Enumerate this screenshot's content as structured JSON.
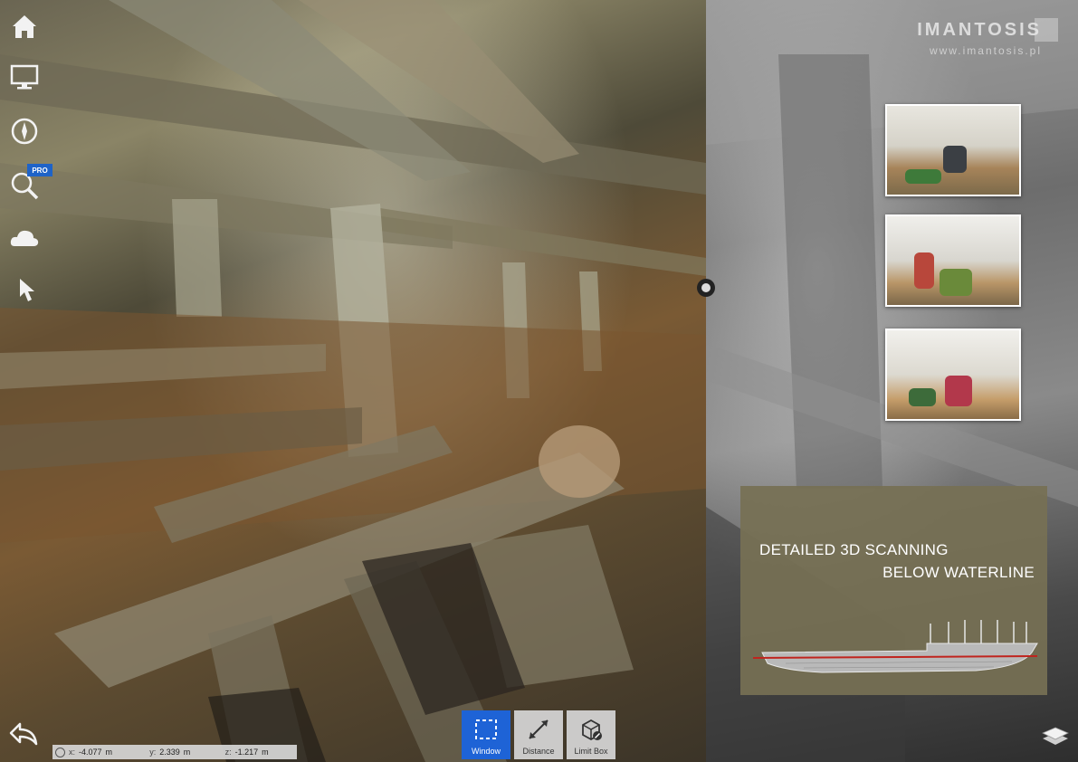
{
  "toolbar": {
    "items": [
      {
        "name": "home-icon"
      },
      {
        "name": "monitor-icon"
      },
      {
        "name": "compass-icon"
      },
      {
        "name": "search-zoom-icon",
        "badge": "PRO"
      },
      {
        "name": "cloud-icon"
      },
      {
        "name": "pointer-icon"
      }
    ]
  },
  "logo": {
    "text": "IMANTOSIS",
    "url": "www.imantosis.pl"
  },
  "info_panel": {
    "line1": "DETAILED 3D SCANNING",
    "line2": "BELOW WATERLINE"
  },
  "coordinates": {
    "x_label": "x:",
    "x_value": "-4.077",
    "x_unit": "m",
    "y_label": "y:",
    "y_value": "2.339",
    "y_unit": "m",
    "z_label": "z:",
    "z_value": "-1.217",
    "z_unit": "m"
  },
  "measure_tools": {
    "window": "Window",
    "distance": "Distance",
    "limit_box": "Limit Box"
  },
  "colors": {
    "accent": "#1e63d6",
    "panel": "#767054",
    "waterline": "#c0241e"
  }
}
